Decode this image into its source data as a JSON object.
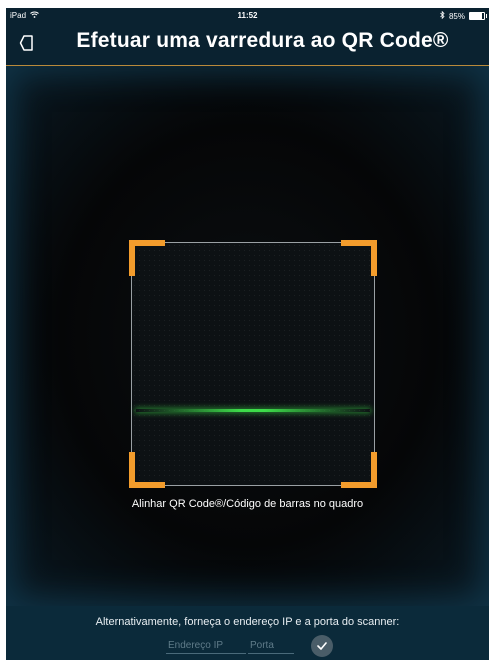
{
  "status_bar": {
    "device": "iPad",
    "time": "11:52",
    "battery": "85%",
    "battery_level": 0.85,
    "icons": [
      "wifi-icon",
      "bluetooth-icon",
      "battery-icon"
    ]
  },
  "header": {
    "title": "Efetuar uma varredura ao QR Code®",
    "back_icon": "back-arrow-icon"
  },
  "scanner": {
    "instruction": "Alinhar QR Code®/Código de barras no quadro",
    "frame_color": "#f39c2c",
    "scan_line_color": "#3ddc4a"
  },
  "manual_entry": {
    "prompt": "Alternativamente, forneça o endereço IP e a porta do scanner:",
    "ip_placeholder": "Endereço IP",
    "port_placeholder": "Porta",
    "confirm_icon": "checkmark-icon"
  },
  "colors": {
    "background": "#0a2230",
    "accent": "#b98a3a"
  }
}
